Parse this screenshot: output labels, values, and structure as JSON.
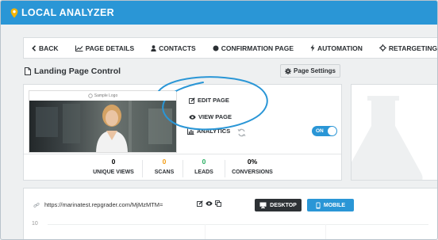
{
  "app": {
    "title": "LOCAL ANALYZER"
  },
  "nav": {
    "items": [
      {
        "label": "BACK",
        "icon": "chevron-left-icon"
      },
      {
        "label": "PAGE DETAILS",
        "icon": "line-chart-icon"
      },
      {
        "label": "CONTACTS",
        "icon": "user-icon"
      },
      {
        "label": "CONFIRMATION PAGE",
        "icon": "circle-icon"
      },
      {
        "label": "AUTOMATION",
        "icon": "bolt-icon"
      },
      {
        "label": "RETARGETING",
        "icon": "crosshair-icon"
      }
    ]
  },
  "page": {
    "title": "Landing Page Control",
    "settings_label": "Page Settings"
  },
  "card": {
    "thumb_caption": "Sample Logo",
    "edit_label": "EDIT PAGE",
    "view_label": "VIEW PAGE",
    "analytics_label": "ANALYTICS",
    "toggle_label": "ON",
    "stats": [
      {
        "value": "0",
        "label": "UNIQUE VIEWS",
        "color": "#2b2f33"
      },
      {
        "value": "0",
        "label": "SCANS",
        "color": "#f39c12"
      },
      {
        "value": "0",
        "label": "LEADS",
        "color": "#27ae60"
      },
      {
        "value": "0%",
        "label": "CONVERSIONS",
        "color": "#2b2f33"
      }
    ]
  },
  "url_panel": {
    "url": "https://marinatest.repgrader.com/MjMzMTM=",
    "desktop_label": "DESKTOP",
    "mobile_label": "MOBILE",
    "y_tick": "10"
  },
  "colors": {
    "brand": "#2a96d6",
    "dark": "#2d3135"
  }
}
